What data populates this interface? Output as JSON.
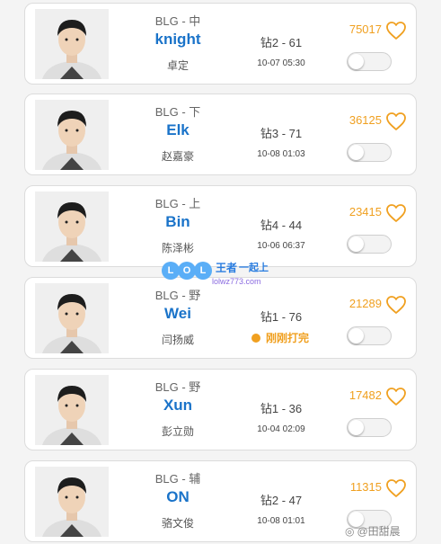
{
  "players": [
    {
      "team": "BLG - 中",
      "name": "knight",
      "cname": "卓定",
      "rank": "钻2 - 61",
      "status": "10-07 05:30",
      "status_type": "time",
      "likes": "75017"
    },
    {
      "team": "BLG - 下",
      "name": "Elk",
      "cname": "赵嘉豪",
      "rank": "钻3 - 71",
      "status": "10-08 01:03",
      "status_type": "time",
      "likes": "36125"
    },
    {
      "team": "BLG - 上",
      "name": "Bin",
      "cname": "陈泽彬",
      "rank": "钻4 - 44",
      "status": "10-06 06:37",
      "status_type": "time",
      "likes": "23415"
    },
    {
      "team": "BLG - 野",
      "name": "Wei",
      "cname": "闫扬威",
      "rank": "钻1 - 76",
      "status": "刚刚打完",
      "status_type": "live",
      "likes": "21289"
    },
    {
      "team": "BLG - 野",
      "name": "Xun",
      "cname": "彭立勋",
      "rank": "钻1 - 36",
      "status": "10-04 02:09",
      "status_type": "time",
      "likes": "17482"
    },
    {
      "team": "BLG - 辅",
      "name": "ON",
      "cname": "骆文俊",
      "rank": "钻2 - 47",
      "status": "10-08 01:01",
      "status_type": "time",
      "likes": "11315"
    }
  ],
  "watermark": {
    "letters": [
      "L",
      "O",
      "L"
    ],
    "brand": "王者",
    "brand_suffix": "一起上",
    "url": "lolwz773.com",
    "weibo": "@田甜晨"
  },
  "colors": {
    "accent": "#f0a020",
    "name_blue": "#1a73c9"
  }
}
